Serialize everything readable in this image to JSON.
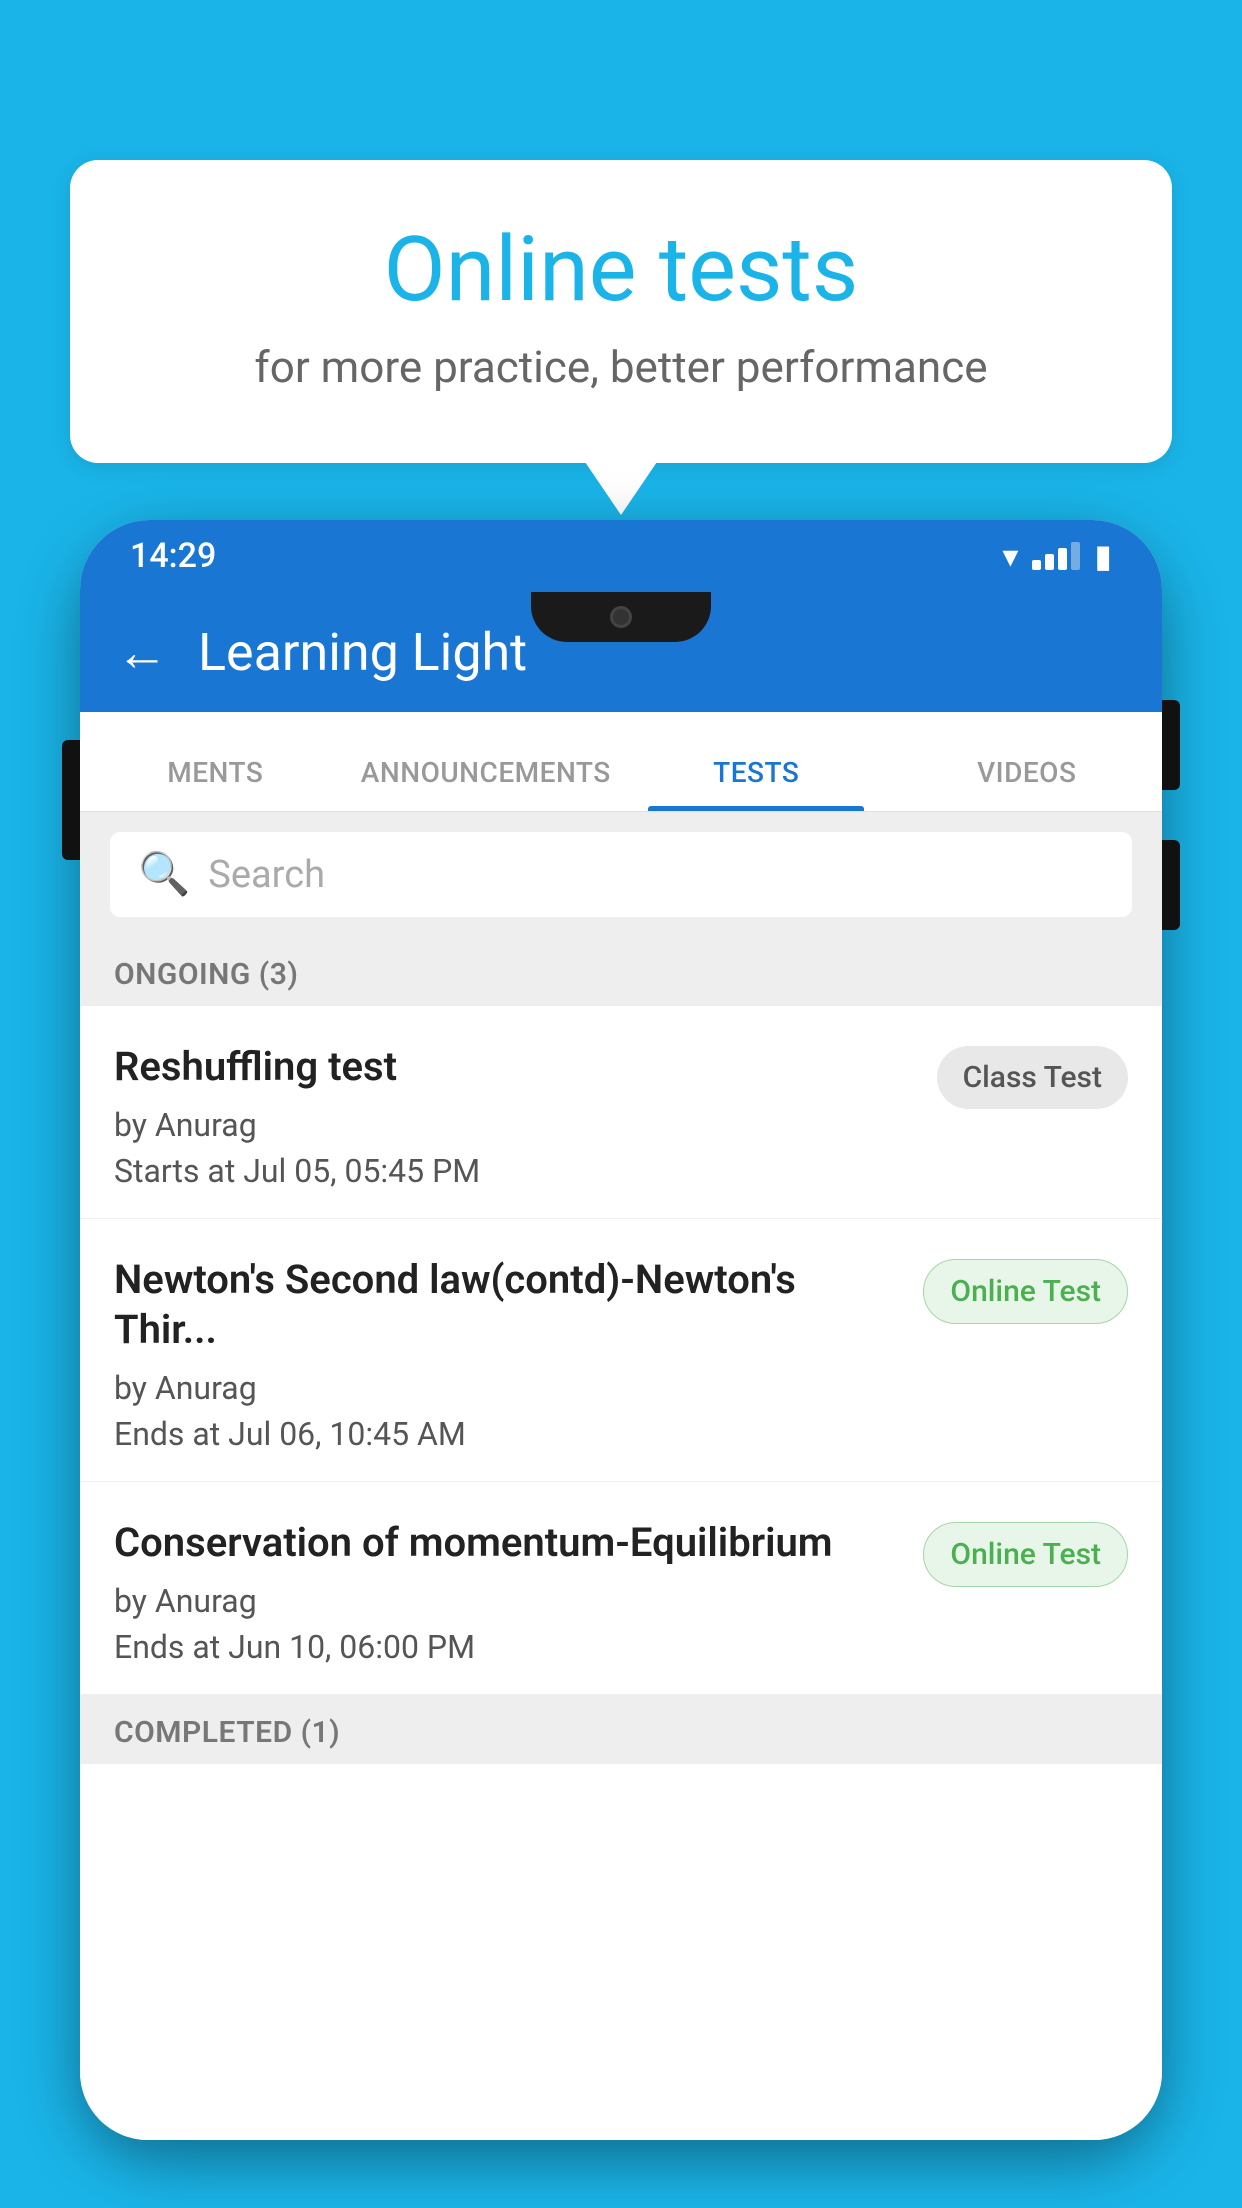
{
  "background_color": "#1ab4e8",
  "speech_bubble": {
    "title": "Online tests",
    "subtitle": "for more practice, better performance"
  },
  "phone": {
    "status_bar": {
      "time": "14:29"
    },
    "app_bar": {
      "title": "Learning Light",
      "back_label": "←"
    },
    "tabs": [
      {
        "label": "MENTS",
        "active": false
      },
      {
        "label": "ANNOUNCEMENTS",
        "active": false
      },
      {
        "label": "TESTS",
        "active": true
      },
      {
        "label": "VIDEOS",
        "active": false
      }
    ],
    "search": {
      "placeholder": "Search"
    },
    "ongoing_section": {
      "label": "ONGOING (3)"
    },
    "tests": [
      {
        "name": "Reshuffling test",
        "author": "by Anurag",
        "date": "Starts at  Jul 05, 05:45 PM",
        "badge": "Class Test",
        "badge_type": "class"
      },
      {
        "name": "Newton's Second law(contd)-Newton's Thir...",
        "author": "by Anurag",
        "date": "Ends at  Jul 06, 10:45 AM",
        "badge": "Online Test",
        "badge_type": "online"
      },
      {
        "name": "Conservation of momentum-Equilibrium",
        "author": "by Anurag",
        "date": "Ends at  Jun 10, 06:00 PM",
        "badge": "Online Test",
        "badge_type": "online"
      }
    ],
    "completed_section": {
      "label": "COMPLETED (1)"
    }
  }
}
